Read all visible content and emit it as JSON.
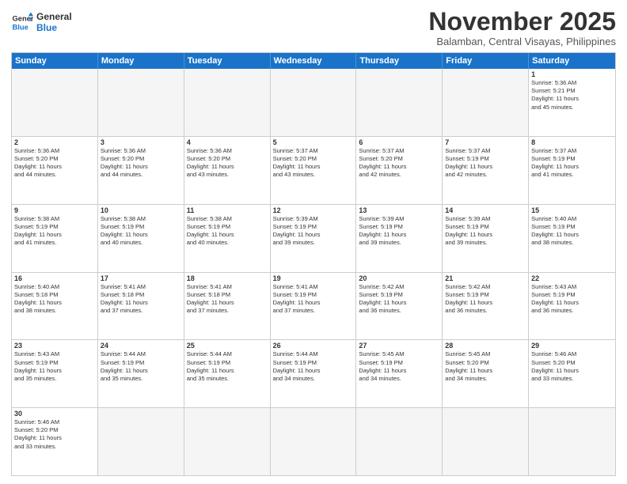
{
  "logo": {
    "line1": "General",
    "line2": "Blue"
  },
  "title": "November 2025",
  "location": "Balamban, Central Visayas, Philippines",
  "header_days": [
    "Sunday",
    "Monday",
    "Tuesday",
    "Wednesday",
    "Thursday",
    "Friday",
    "Saturday"
  ],
  "rows": [
    [
      {
        "day": "",
        "info": ""
      },
      {
        "day": "",
        "info": ""
      },
      {
        "day": "",
        "info": ""
      },
      {
        "day": "",
        "info": ""
      },
      {
        "day": "",
        "info": ""
      },
      {
        "day": "",
        "info": ""
      },
      {
        "day": "1",
        "info": "Sunrise: 5:36 AM\nSunset: 5:21 PM\nDaylight: 11 hours\nand 45 minutes."
      }
    ],
    [
      {
        "day": "2",
        "info": "Sunrise: 5:36 AM\nSunset: 5:20 PM\nDaylight: 11 hours\nand 44 minutes."
      },
      {
        "day": "3",
        "info": "Sunrise: 5:36 AM\nSunset: 5:20 PM\nDaylight: 11 hours\nand 44 minutes."
      },
      {
        "day": "4",
        "info": "Sunrise: 5:36 AM\nSunset: 5:20 PM\nDaylight: 11 hours\nand 43 minutes."
      },
      {
        "day": "5",
        "info": "Sunrise: 5:37 AM\nSunset: 5:20 PM\nDaylight: 11 hours\nand 43 minutes."
      },
      {
        "day": "6",
        "info": "Sunrise: 5:37 AM\nSunset: 5:20 PM\nDaylight: 11 hours\nand 42 minutes."
      },
      {
        "day": "7",
        "info": "Sunrise: 5:37 AM\nSunset: 5:19 PM\nDaylight: 11 hours\nand 42 minutes."
      },
      {
        "day": "8",
        "info": "Sunrise: 5:37 AM\nSunset: 5:19 PM\nDaylight: 11 hours\nand 41 minutes."
      }
    ],
    [
      {
        "day": "9",
        "info": "Sunrise: 5:38 AM\nSunset: 5:19 PM\nDaylight: 11 hours\nand 41 minutes."
      },
      {
        "day": "10",
        "info": "Sunrise: 5:38 AM\nSunset: 5:19 PM\nDaylight: 11 hours\nand 40 minutes."
      },
      {
        "day": "11",
        "info": "Sunrise: 5:38 AM\nSunset: 5:19 PM\nDaylight: 11 hours\nand 40 minutes."
      },
      {
        "day": "12",
        "info": "Sunrise: 5:39 AM\nSunset: 5:19 PM\nDaylight: 11 hours\nand 39 minutes."
      },
      {
        "day": "13",
        "info": "Sunrise: 5:39 AM\nSunset: 5:19 PM\nDaylight: 11 hours\nand 39 minutes."
      },
      {
        "day": "14",
        "info": "Sunrise: 5:39 AM\nSunset: 5:19 PM\nDaylight: 11 hours\nand 39 minutes."
      },
      {
        "day": "15",
        "info": "Sunrise: 5:40 AM\nSunset: 5:19 PM\nDaylight: 11 hours\nand 38 minutes."
      }
    ],
    [
      {
        "day": "16",
        "info": "Sunrise: 5:40 AM\nSunset: 5:18 PM\nDaylight: 11 hours\nand 38 minutes."
      },
      {
        "day": "17",
        "info": "Sunrise: 5:41 AM\nSunset: 5:18 PM\nDaylight: 11 hours\nand 37 minutes."
      },
      {
        "day": "18",
        "info": "Sunrise: 5:41 AM\nSunset: 5:18 PM\nDaylight: 11 hours\nand 37 minutes."
      },
      {
        "day": "19",
        "info": "Sunrise: 5:41 AM\nSunset: 5:19 PM\nDaylight: 11 hours\nand 37 minutes."
      },
      {
        "day": "20",
        "info": "Sunrise: 5:42 AM\nSunset: 5:19 PM\nDaylight: 11 hours\nand 36 minutes."
      },
      {
        "day": "21",
        "info": "Sunrise: 5:42 AM\nSunset: 5:19 PM\nDaylight: 11 hours\nand 36 minutes."
      },
      {
        "day": "22",
        "info": "Sunrise: 5:43 AM\nSunset: 5:19 PM\nDaylight: 11 hours\nand 36 minutes."
      }
    ],
    [
      {
        "day": "23",
        "info": "Sunrise: 5:43 AM\nSunset: 5:19 PM\nDaylight: 11 hours\nand 35 minutes."
      },
      {
        "day": "24",
        "info": "Sunrise: 5:44 AM\nSunset: 5:19 PM\nDaylight: 11 hours\nand 35 minutes."
      },
      {
        "day": "25",
        "info": "Sunrise: 5:44 AM\nSunset: 5:19 PM\nDaylight: 11 hours\nand 35 minutes."
      },
      {
        "day": "26",
        "info": "Sunrise: 5:44 AM\nSunset: 5:19 PM\nDaylight: 11 hours\nand 34 minutes."
      },
      {
        "day": "27",
        "info": "Sunrise: 5:45 AM\nSunset: 5:19 PM\nDaylight: 11 hours\nand 34 minutes."
      },
      {
        "day": "28",
        "info": "Sunrise: 5:45 AM\nSunset: 5:20 PM\nDaylight: 11 hours\nand 34 minutes."
      },
      {
        "day": "29",
        "info": "Sunrise: 5:46 AM\nSunset: 5:20 PM\nDaylight: 11 hours\nand 33 minutes."
      }
    ],
    [
      {
        "day": "30",
        "info": "Sunrise: 5:46 AM\nSunset: 5:20 PM\nDaylight: 11 hours\nand 33 minutes."
      },
      {
        "day": "",
        "info": ""
      },
      {
        "day": "",
        "info": ""
      },
      {
        "day": "",
        "info": ""
      },
      {
        "day": "",
        "info": ""
      },
      {
        "day": "",
        "info": ""
      },
      {
        "day": "",
        "info": ""
      }
    ]
  ]
}
